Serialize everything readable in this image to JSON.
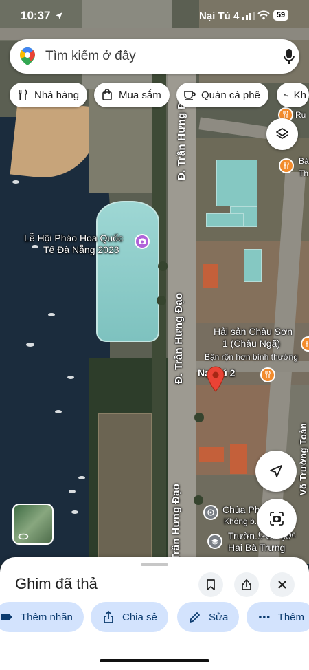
{
  "status_bar": {
    "time": "10:37",
    "carrier": "Nại Tú 4",
    "battery": "59"
  },
  "search": {
    "placeholder": "Tìm kiếm ở đây"
  },
  "chips": [
    {
      "label": "Nhà hàng",
      "icon": "fork-knife-icon"
    },
    {
      "label": "Mua sắm",
      "icon": "shopping-bag-icon"
    },
    {
      "label": "Quán cà phê",
      "icon": "coffee-icon"
    },
    {
      "label": "Kh",
      "icon": "bed-icon"
    }
  ],
  "map": {
    "road_labels": [
      "Đ. Trần Hưng Đạo",
      "Đ. Trần Hưng Đạo",
      "Trần Hưng Đạo"
    ],
    "event_label": [
      "Lễ Hội Pháo Hoa Quốc",
      "Tế Đà Nẵng 2023"
    ],
    "poi_hai_san": [
      "Hải sản Châu Sơn",
      "1 (Châu Ngã)"
    ],
    "poi_hai_san_status": "Bận rộn hơn bình thường",
    "street_nai_tu": "Nại Tú 2",
    "poi_chua": "Chùa Phổ ...ng",
    "poi_chua_sub": "Không b...",
    "poi_school": [
      "Trườn... C...ọc",
      "Hai Bà Trưng"
    ],
    "right_road": "Võ Trường Toản",
    "ru_label": "Ru",
    "ba_label": [
      "Bá",
      "Th"
    ],
    "lens_label": "Ch...emọc",
    "accent_food": "#f28b2c",
    "accent_event": "#b062d9",
    "pin_color": "#ea4335"
  },
  "sheet": {
    "title": "Ghim đã thả"
  },
  "actions": [
    {
      "label": "Thêm nhãn",
      "icon": "label-icon"
    },
    {
      "label": "Chia sẻ",
      "icon": "share-icon"
    },
    {
      "label": "Sửa",
      "icon": "pencil-icon"
    },
    {
      "label": "Thêm",
      "icon": "more-icon"
    }
  ]
}
